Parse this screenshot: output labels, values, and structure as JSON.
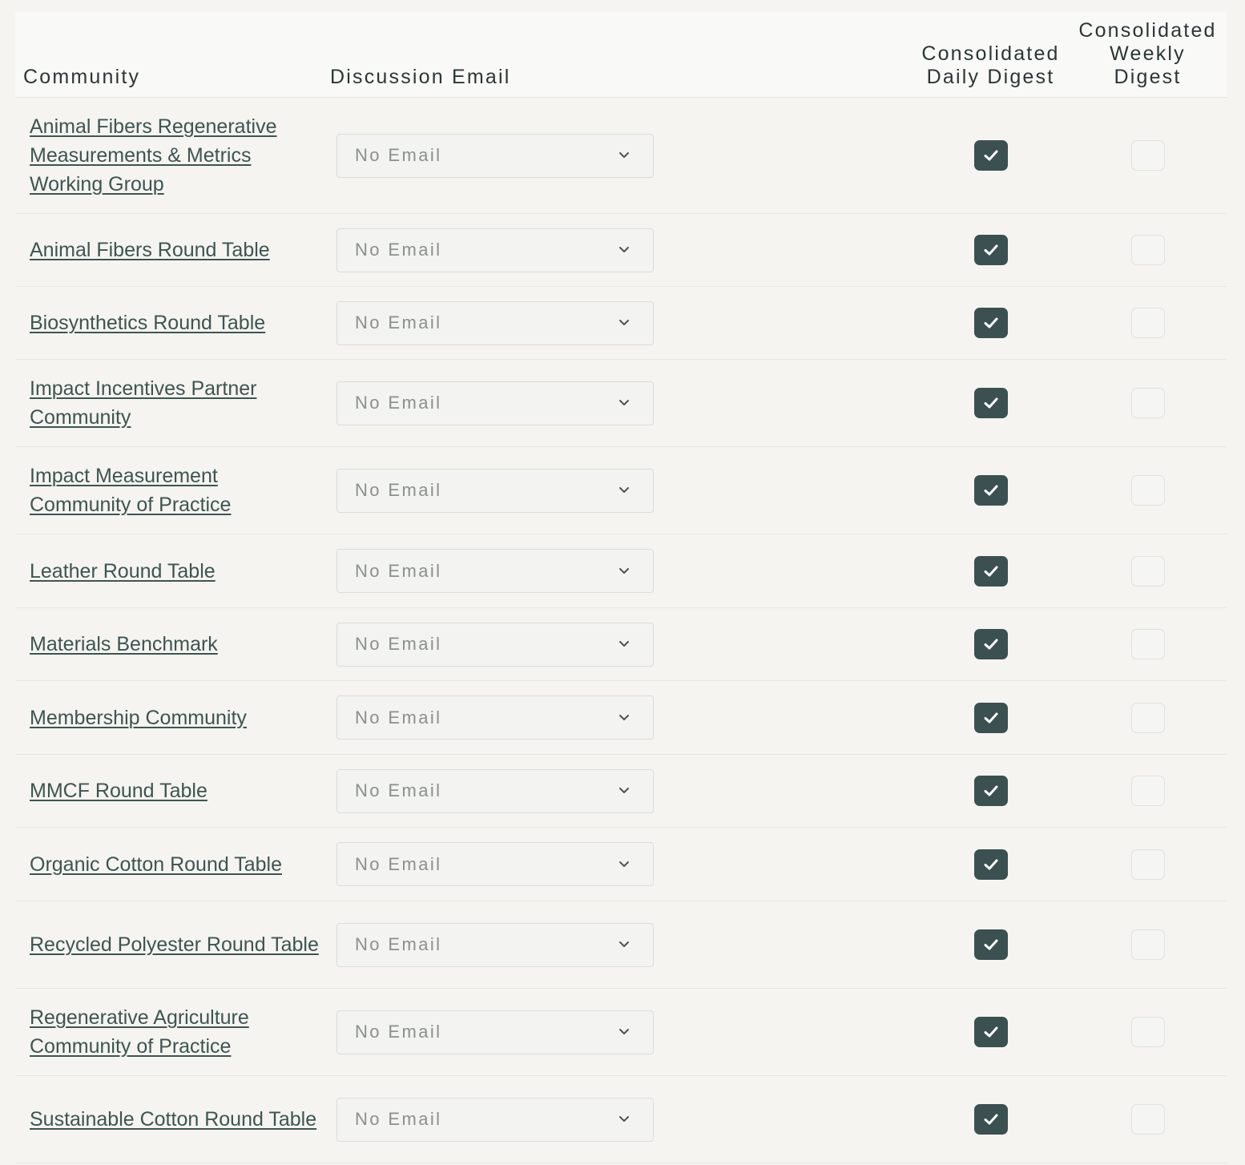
{
  "table": {
    "headers": {
      "community": "Community",
      "discussion_email": "Discussion Email",
      "daily_digest_line1": "Consolidated",
      "daily_digest_line2": "Daily Digest",
      "weekly_digest_line1": "Consolidated",
      "weekly_digest_line2": "Weekly",
      "weekly_digest_line3": "Digest"
    },
    "rows": [
      {
        "community": "Animal Fibers Regenerative Measurements & Metrics Working Group",
        "email": "No Email",
        "daily": true,
        "weekly": false
      },
      {
        "community": "Animal Fibers Round Table",
        "email": "No Email",
        "daily": true,
        "weekly": false
      },
      {
        "community": "Biosynthetics Round Table",
        "email": "No Email",
        "daily": true,
        "weekly": false
      },
      {
        "community": "Impact Incentives Partner Community",
        "email": "No Email",
        "daily": true,
        "weekly": false
      },
      {
        "community": "Impact Measurement Community of Practice",
        "email": "No Email",
        "daily": true,
        "weekly": false
      },
      {
        "community": "Leather Round Table",
        "email": "No Email",
        "daily": true,
        "weekly": false
      },
      {
        "community": "Materials Benchmark",
        "email": "No Email",
        "daily": true,
        "weekly": false
      },
      {
        "community": "Membership Community",
        "email": "No Email",
        "daily": true,
        "weekly": false
      },
      {
        "community": "MMCF Round Table",
        "email": "No Email",
        "daily": true,
        "weekly": false
      },
      {
        "community": "Organic Cotton Round Table",
        "email": "No Email",
        "daily": true,
        "weekly": false
      },
      {
        "community": "Recycled Polyester Round Table",
        "email": "No Email",
        "daily": true,
        "weekly": false
      },
      {
        "community": "Regenerative Agriculture Community of Practice",
        "email": "No Email",
        "daily": true,
        "weekly": false
      },
      {
        "community": "Sustainable Cotton Round Table",
        "email": "No Email",
        "daily": true,
        "weekly": false
      }
    ]
  },
  "icons": {
    "dropdown": "chevron-down-icon",
    "check": "check-icon"
  },
  "colors": {
    "background": "#f5f4f0",
    "checked_fill": "#3b5050",
    "link": "#3d5552"
  }
}
